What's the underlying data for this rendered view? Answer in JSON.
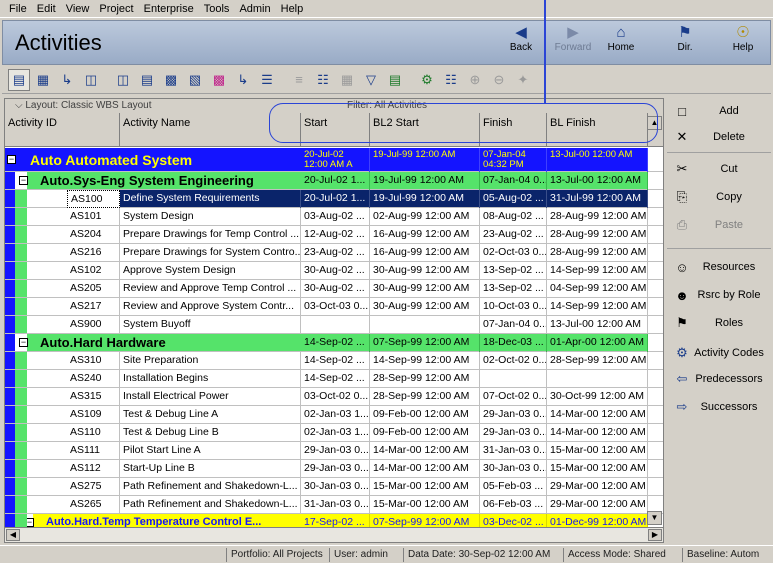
{
  "menu": [
    "File",
    "Edit",
    "View",
    "Project",
    "Enterprise",
    "Tools",
    "Admin",
    "Help"
  ],
  "title": "Activities",
  "nav": {
    "back": "Back",
    "forward": "Forward",
    "home": "Home",
    "dir": "Dir.",
    "help": "Help"
  },
  "layout_label": "Layout: Classic WBS Layout",
  "filter_label": "Filter: All Activities",
  "columns": {
    "id": "Activity ID",
    "name": "Activity Name",
    "start": "Start",
    "bl2start": "BL2 Start",
    "finish": "Finish",
    "blfinish": "BL Finish"
  },
  "rows": [
    {
      "kind": "wbs1",
      "id": "Auto  Automated System",
      "name": "",
      "start": "20-Jul-02 12:00 AM A",
      "bl2start": "19-Jul-99 12:00 AM",
      "finish": "07-Jan-04 04:32 PM",
      "blfinish": "13-Jul-00 12:00 AM"
    },
    {
      "kind": "wbs2",
      "id": "Auto.Sys-Eng  System Engineering",
      "name": "",
      "start": "20-Jul-02 1...",
      "bl2start": "19-Jul-99 12:00 AM",
      "finish": "07-Jan-04 0...",
      "blfinish": "13-Jul-00 12:00 AM"
    },
    {
      "kind": "sel",
      "id": "AS100",
      "name": "Define System Requirements",
      "start": "20-Jul-02 1...",
      "bl2start": "19-Jul-99 12:00 AM",
      "finish": "05-Aug-02 ...",
      "blfinish": "31-Jul-99 12:00 AM"
    },
    {
      "kind": "act",
      "id": "AS101",
      "name": "System Design",
      "start": "03-Aug-02 ...",
      "bl2start": "02-Aug-99 12:00 AM",
      "finish": "08-Aug-02 ...",
      "blfinish": "28-Aug-99 12:00 AM"
    },
    {
      "kind": "act",
      "id": "AS204",
      "name": "Prepare Drawings for Temp Control ...",
      "start": "12-Aug-02 ...",
      "bl2start": "16-Aug-99 12:00 AM",
      "finish": "23-Aug-02 ...",
      "blfinish": "28-Aug-99 12:00 AM"
    },
    {
      "kind": "act",
      "id": "AS216",
      "name": "Prepare Drawings for System Contro...",
      "start": "23-Aug-02 ...",
      "bl2start": "16-Aug-99 12:00 AM",
      "finish": "02-Oct-03 0...",
      "blfinish": "28-Aug-99 12:00 AM"
    },
    {
      "kind": "act",
      "id": "AS102",
      "name": "Approve System Design",
      "start": "30-Aug-02 ...",
      "bl2start": "30-Aug-99 12:00 AM",
      "finish": "13-Sep-02 ...",
      "blfinish": "14-Sep-99 12:00 AM"
    },
    {
      "kind": "act",
      "id": "AS205",
      "name": "Review and Approve Temp Control ...",
      "start": "30-Aug-02 ...",
      "bl2start": "30-Aug-99 12:00 AM",
      "finish": "13-Sep-02 ...",
      "blfinish": "04-Sep-99 12:00 AM"
    },
    {
      "kind": "act",
      "id": "AS217",
      "name": "Review and Approve System Contr...",
      "start": "03-Oct-03 0...",
      "bl2start": "30-Aug-99 12:00 AM",
      "finish": "10-Oct-03 0...",
      "blfinish": "14-Sep-99 12:00 AM"
    },
    {
      "kind": "act",
      "id": "AS900",
      "name": "System Buyoff",
      "start": "",
      "bl2start": "",
      "finish": "07-Jan-04 0...",
      "blfinish": "13-Jul-00 12:00 AM"
    },
    {
      "kind": "wbs2",
      "id": "Auto.Hard  Hardware",
      "name": "",
      "start": "14-Sep-02 ...",
      "bl2start": "07-Sep-99 12:00 AM",
      "finish": "18-Dec-03 ...",
      "blfinish": "01-Apr-00 12:00 AM"
    },
    {
      "kind": "act",
      "id": "AS310",
      "name": "Site Preparation",
      "start": "14-Sep-02 ...",
      "bl2start": "14-Sep-99 12:00 AM",
      "finish": "02-Oct-02 0...",
      "blfinish": "28-Sep-99 12:00 AM"
    },
    {
      "kind": "act",
      "id": "AS240",
      "name": "Installation Begins",
      "start": "14-Sep-02 ...",
      "bl2start": "28-Sep-99 12:00 AM",
      "finish": "",
      "blfinish": ""
    },
    {
      "kind": "act",
      "id": "AS315",
      "name": "Install Electrical Power",
      "start": "03-Oct-02 0...",
      "bl2start": "28-Sep-99 12:00 AM",
      "finish": "07-Oct-02 0...",
      "blfinish": "30-Oct-99 12:00 AM"
    },
    {
      "kind": "act",
      "id": "AS109",
      "name": "Test & Debug Line A",
      "start": "02-Jan-03 1...",
      "bl2start": "09-Feb-00 12:00 AM",
      "finish": "29-Jan-03 0...",
      "blfinish": "14-Mar-00 12:00 AM"
    },
    {
      "kind": "act",
      "id": "AS110",
      "name": "Test & Debug Line B",
      "start": "02-Jan-03 1...",
      "bl2start": "09-Feb-00 12:00 AM",
      "finish": "29-Jan-03 0...",
      "blfinish": "14-Mar-00 12:00 AM"
    },
    {
      "kind": "act",
      "id": "AS111",
      "name": "Pilot Start Line A",
      "start": "29-Jan-03 0...",
      "bl2start": "14-Mar-00 12:00 AM",
      "finish": "31-Jan-03 0...",
      "blfinish": "15-Mar-00 12:00 AM"
    },
    {
      "kind": "act",
      "id": "AS112",
      "name": "Start-Up Line B",
      "start": "29-Jan-03 0...",
      "bl2start": "14-Mar-00 12:00 AM",
      "finish": "30-Jan-03 0...",
      "blfinish": "15-Mar-00 12:00 AM"
    },
    {
      "kind": "act",
      "id": "AS275",
      "name": "Path Refinement and Shakedown-L...",
      "start": "30-Jan-03 0...",
      "bl2start": "15-Mar-00 12:00 AM",
      "finish": "05-Feb-03 ...",
      "blfinish": "29-Mar-00 12:00 AM"
    },
    {
      "kind": "act",
      "id": "AS265",
      "name": "Path Refinement and Shakedown-L...",
      "start": "31-Jan-03 0...",
      "bl2start": "15-Mar-00 12:00 AM",
      "finish": "06-Feb-03 ...",
      "blfinish": "29-Mar-00 12:00 AM"
    },
    {
      "kind": "wbs3",
      "id": "Auto.Hard.Temp  Temperature Control E...",
      "name": "",
      "start": "17-Sep-02 ...",
      "bl2start": "07-Sep-99 12:00 AM",
      "finish": "03-Dec-02 ...",
      "blfinish": "01-Dec-99 12:00 AM"
    }
  ],
  "side_buttons": [
    {
      "label": "Add",
      "icon": "add-icon",
      "enabled": true
    },
    {
      "label": "Delete",
      "icon": "delete-icon",
      "enabled": true
    },
    {
      "label": "Cut",
      "icon": "cut-icon",
      "enabled": true
    },
    {
      "label": "Copy",
      "icon": "copy-icon",
      "enabled": true
    },
    {
      "label": "Paste",
      "icon": "paste-icon",
      "enabled": false
    },
    {
      "label": "Resources",
      "icon": "resources-icon",
      "enabled": true
    },
    {
      "label": "Rsrc by Role",
      "icon": "rsrc-by-role-icon",
      "enabled": true
    },
    {
      "label": "Roles",
      "icon": "roles-icon",
      "enabled": true
    },
    {
      "label": "Activity Codes",
      "icon": "activity-codes-icon",
      "enabled": true
    },
    {
      "label": "Predecessors",
      "icon": "predecessors-icon",
      "enabled": true
    },
    {
      "label": "Successors",
      "icon": "successors-icon",
      "enabled": true
    }
  ],
  "status": {
    "portfolio": "Portfolio: All Projects",
    "user": "User: admin",
    "data_date": "Data Date: 30-Sep-02 12:00 AM",
    "access": "Access Mode: Shared",
    "baseline": "Baseline: Autom"
  },
  "colors": {
    "wbs1": "#1414ff",
    "wbs2": "#55e36a",
    "wbs3": "#ffff00",
    "selected": "#0a246a",
    "callout": "#2b45d6"
  }
}
